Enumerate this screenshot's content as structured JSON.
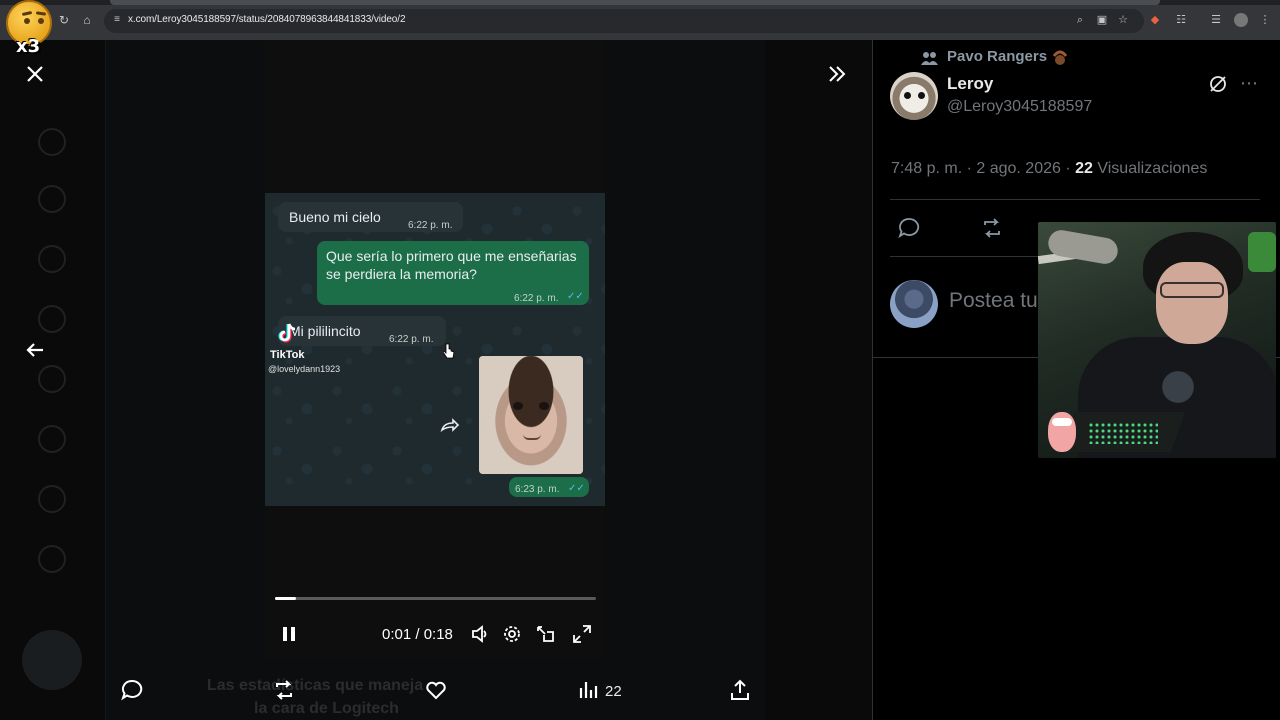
{
  "browser": {
    "url": "x.com/Leroy3045188597/status/2084078963844841833/video/2"
  },
  "overlay": {
    "emoji_counter": "x3"
  },
  "chat": {
    "messages": [
      {
        "direction": "in",
        "text": "Bueno mi cielo",
        "time": "6:22 p. m."
      },
      {
        "direction": "out",
        "text": "Que sería lo primero que me enseñarias se perdiera la memoria?",
        "time": "6:22 p. m."
      },
      {
        "direction": "in",
        "text": "Mi pililincito",
        "time": "6:22 p. m."
      },
      {
        "direction": "out",
        "text": "",
        "time": "6:23 p. m."
      }
    ],
    "watermark": {
      "name": "TikTok",
      "handle": "@lovelydann1923"
    }
  },
  "player": {
    "time_display": "0:01 / 0:18",
    "progress": 0.066
  },
  "action_bar": {
    "views": "22"
  },
  "background_text": {
    "line1": "Las estadísticas que maneja",
    "line2": "la cara de Logitech"
  },
  "tweet": {
    "community": "Pavo Rangers",
    "author_name": "Leroy",
    "author_handle": "@Leroy3045188597",
    "timestamp": "7:48 p. m. · 2 ago. 2026 · ",
    "views_count": "22",
    "views_label": " Visualizaciones",
    "reply_placeholder": "Postea tu respuesta"
  },
  "colors": {
    "accent_out_bubble": "#1c6e49",
    "in_bubble": "#283338",
    "text_secondary": "#71767b"
  }
}
